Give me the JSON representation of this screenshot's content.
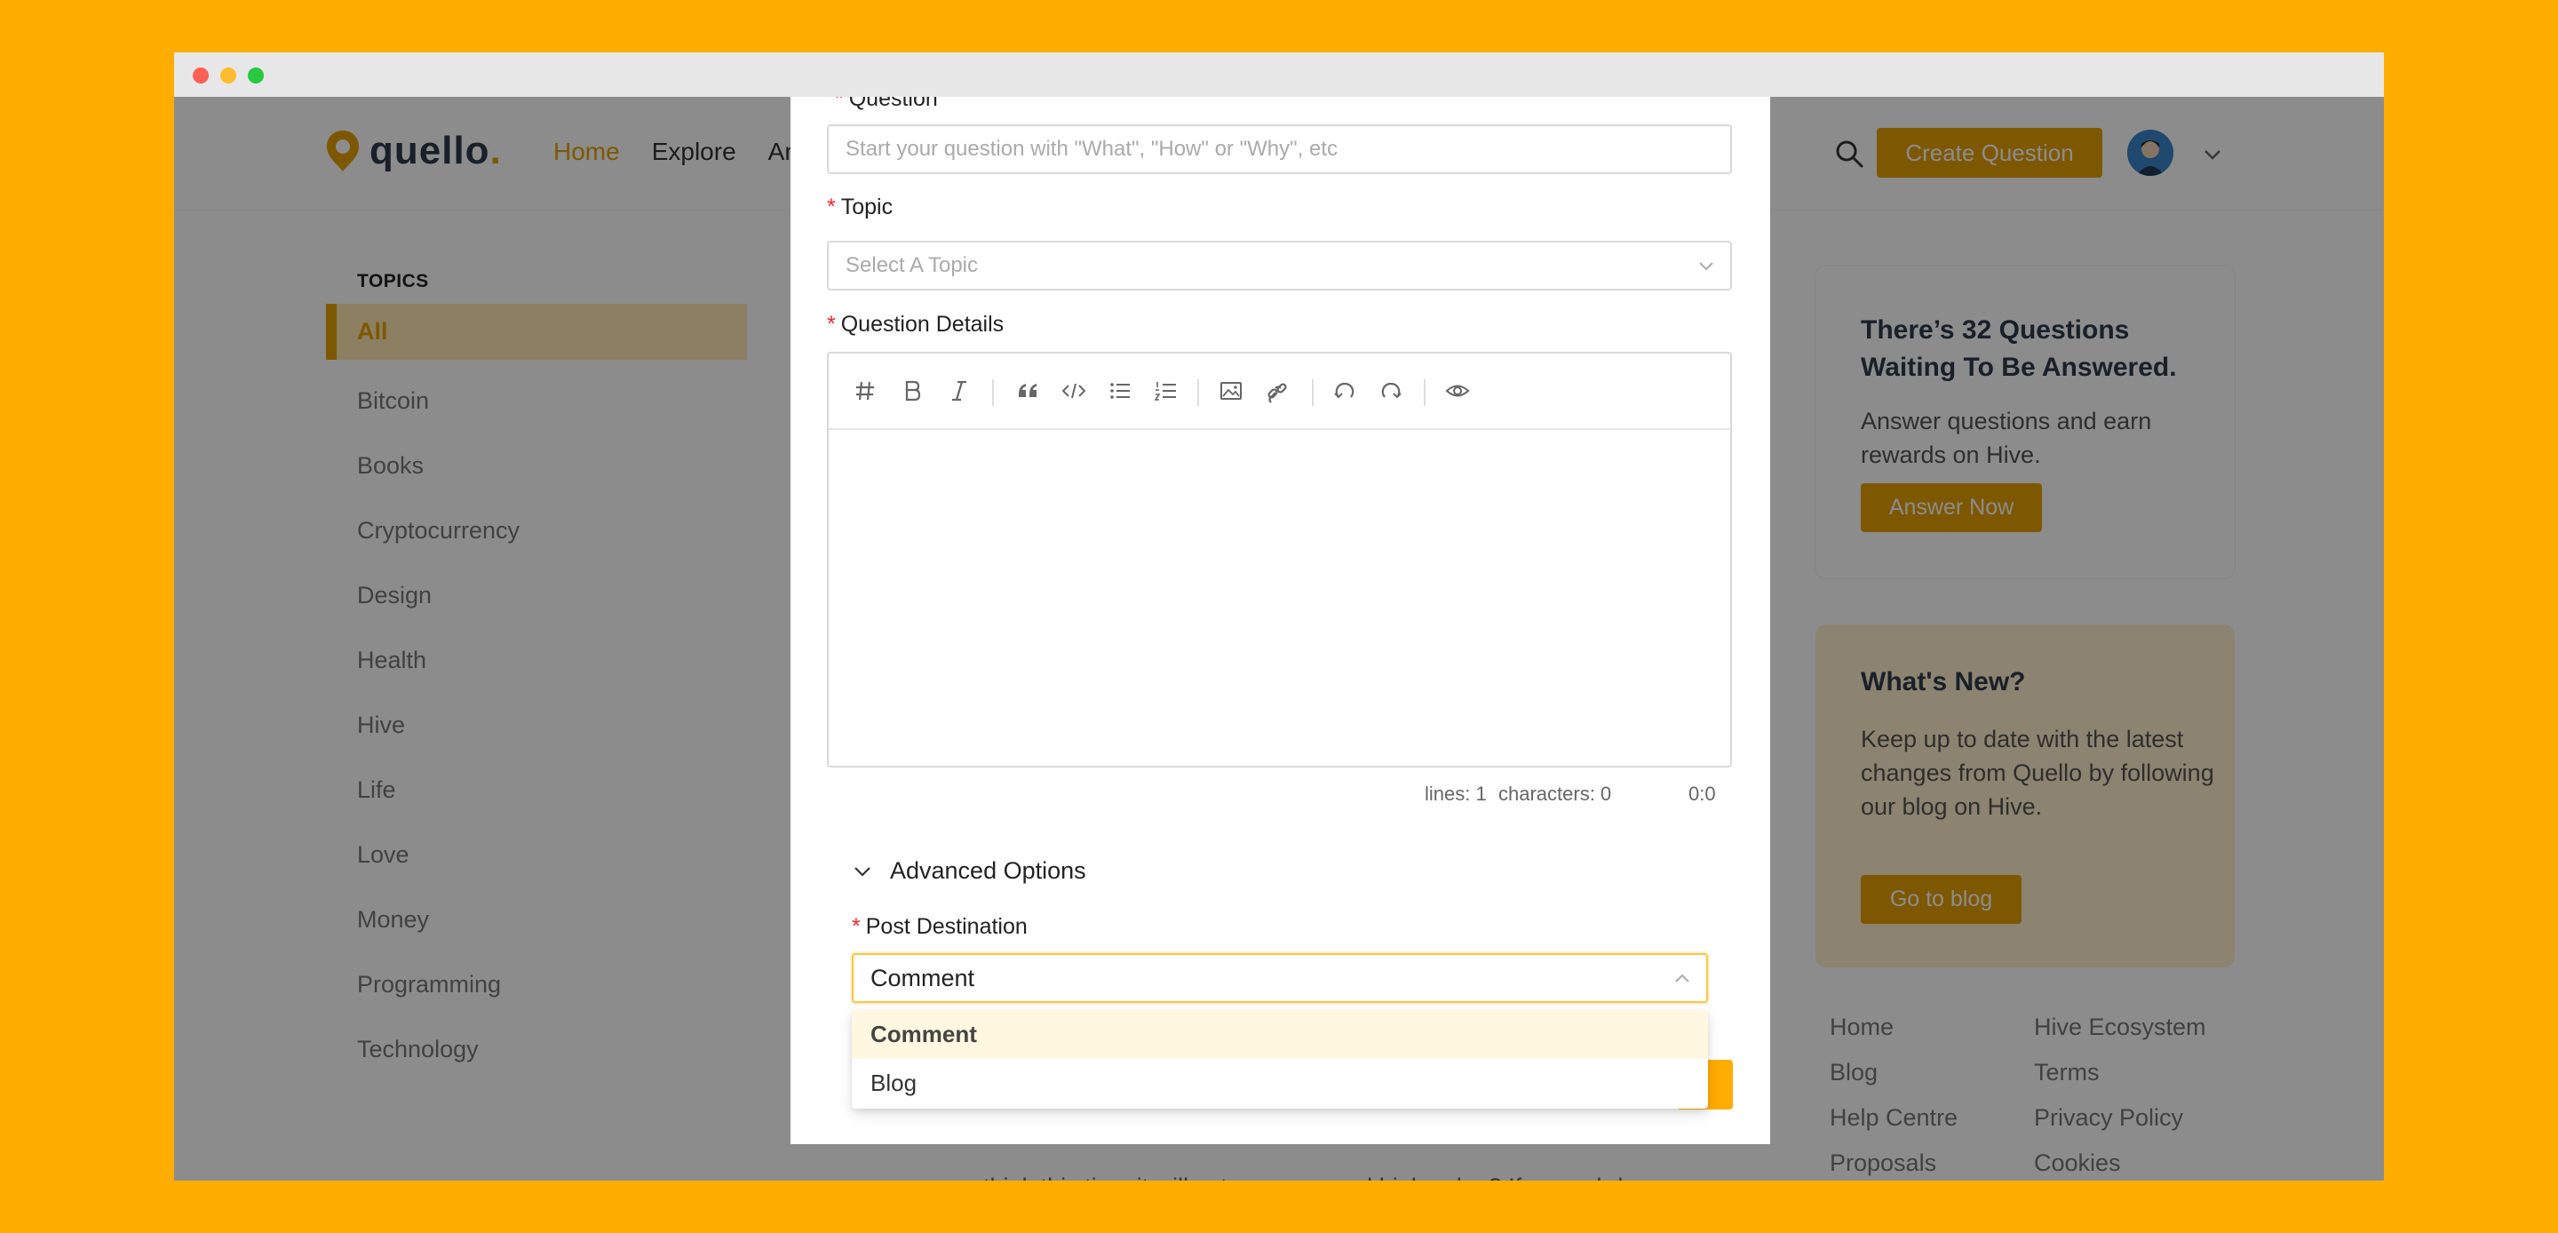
{
  "app": {
    "logo_text": "quello",
    "logo_dot": "."
  },
  "header": {
    "nav": [
      "Home",
      "Explore",
      "An"
    ],
    "active_nav": "Home",
    "create_button": "Create Question",
    "icons": [
      "search-icon",
      "avatar",
      "chevron-down-icon"
    ]
  },
  "sidebar": {
    "heading": "TOPICS",
    "topics": [
      "All",
      "Bitcoin",
      "Books",
      "Cryptocurrency",
      "Design",
      "Health",
      "Hive",
      "Life",
      "Love",
      "Money",
      "Programming",
      "Technology"
    ],
    "active_topic": "All"
  },
  "right": {
    "card1": {
      "title": "There’s 32 Questions Waiting To Be Answered.",
      "body": "Answer questions and earn rewards on Hive.",
      "button": "Answer Now"
    },
    "card2": {
      "title": "What's New?",
      "body": "Keep up to date with the latest changes from Quello by following our blog on Hive.",
      "button": "Go to blog"
    },
    "footer_links": [
      "Home",
      "Hive Ecosystem",
      "Blog",
      "Terms",
      "Help Centre",
      "Privacy Policy",
      "Proposals",
      "Cookies"
    ]
  },
  "feed": {
    "preview_text": "you think this time it will set a new record high value? If yes, whd..."
  },
  "modal": {
    "question_label": "Question",
    "question_placeholder": "Start your question with \"What\", \"How\" or \"Why\", etc",
    "topic_label": "Topic",
    "topic_placeholder": "Select A Topic",
    "details_label": "Question Details",
    "editor_toolbar": [
      "heading-icon",
      "bold-icon",
      "italic-icon",
      "quote-icon",
      "code-icon",
      "unordered-list-icon",
      "ordered-list-icon",
      "image-icon",
      "link-icon",
      "undo-icon",
      "redo-icon",
      "preview-icon"
    ],
    "status": {
      "lines": "lines: 1",
      "characters": "characters: 0",
      "cursor": "0:0"
    },
    "advanced_label": "Advanced Options",
    "destination_label": "Post Destination",
    "destination_value": "Comment",
    "destination_options": [
      "Comment",
      "Blog"
    ],
    "required_mark": "*"
  },
  "colors": {
    "background": "#FFAD00",
    "accent": "#E6A100",
    "required": "#F5222D"
  }
}
